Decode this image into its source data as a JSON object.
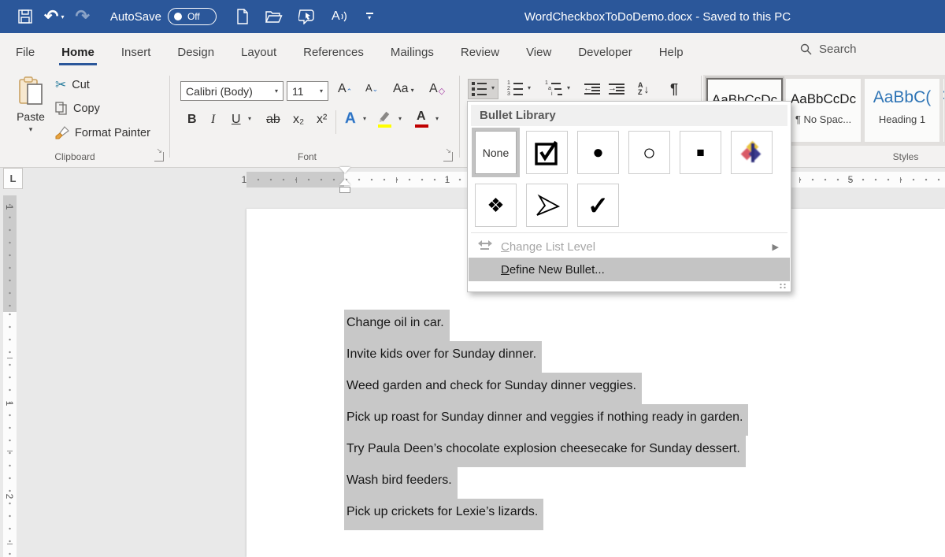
{
  "titlebar": {
    "title": "WordCheckboxToDoDemo.docx  -  Saved to this PC",
    "autosave_label": "AutoSave",
    "autosave_state": "Off",
    "undo_glyph": "↶",
    "redo_glyph": "↷"
  },
  "tabs": {
    "file": "File",
    "home": "Home",
    "insert": "Insert",
    "design": "Design",
    "layout": "Layout",
    "references": "References",
    "mailings": "Mailings",
    "review": "Review",
    "view": "View",
    "developer": "Developer",
    "help": "Help",
    "search": "Search"
  },
  "clipboard": {
    "group": "Clipboard",
    "paste": "Paste",
    "cut": "Cut",
    "copy": "Copy",
    "format_painter": "Format Painter",
    "cut_glyph": "✂"
  },
  "font": {
    "group": "Font",
    "name": "Calibri (Body)",
    "size": "11",
    "grow": "A",
    "shrink": "A",
    "change_case": "Aa",
    "clear": "A",
    "bold": "B",
    "italic": "I",
    "underline": "U",
    "strike": "ab",
    "subscript": "x₂",
    "superscript": "x²",
    "effects": "A",
    "font_color": "A"
  },
  "paragraph": {
    "sort_a": "A",
    "sort_z": "Z",
    "sort_arrow": "↓",
    "pilcrow": "¶",
    "num1": "1",
    "num2": "2",
    "num3": "3",
    "ml1": "1",
    "ml2": "a",
    "ml3": "i",
    "dec_arrow": "←",
    "inc_arrow": "→"
  },
  "styles": {
    "group": "Styles",
    "s1_preview": "AaBbCcDc",
    "s2_preview": "AaBbCcDc",
    "s2_label": "¶ No Spac...",
    "s3_preview": "AaBbC(",
    "s3_label": "Heading 1",
    "s4_preview": "A"
  },
  "ruler": {
    "corner": "L",
    "h_margin_num": "1",
    "h_num_1": "1",
    "h_num_5": "5",
    "v_margin_num": "1",
    "v_num_1": "1",
    "v_num_2": "2"
  },
  "bullet_menu": {
    "title": "Bullet Library",
    "none": "None",
    "dot": "●",
    "circle": "○",
    "square": "■",
    "diamonds": "❖",
    "check": "✓",
    "change_list_level": "Change List Level",
    "submenu_arrow": "▶",
    "define_new_bullet": "Define New Bullet..."
  },
  "document": {
    "lines": [
      "Change oil in car.",
      "Invite kids over for Sunday dinner.",
      "Weed garden and check for Sunday dinner veggies.",
      "Pick up roast for Sunday dinner and veggies if nothing ready in garden.",
      "Try Paula Deen’s chocolate explosion cheesecake for Sunday dessert.",
      "Wash bird feeders.",
      "Pick up crickets for Lexie’s lizards."
    ]
  },
  "colors": {
    "titlebar_blue": "#2b579a",
    "accent_blue": "#2b579a",
    "heading_blue": "#2e74b5",
    "selection_gray": "#c8c8c8",
    "highlight_yellow": "#ffff00",
    "font_color_red": "#c00000"
  }
}
